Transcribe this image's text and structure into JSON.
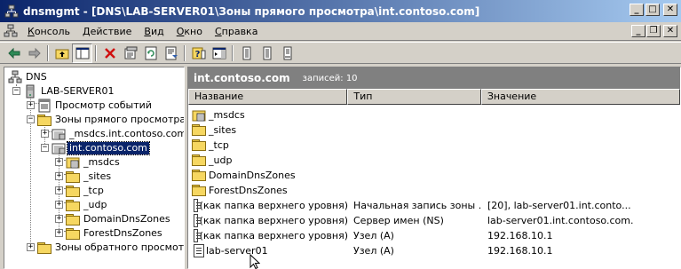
{
  "window": {
    "title": "dnsmgmt - [DNS\\LAB-SERVER01\\Зоны прямого просмотра\\int.contoso.com]"
  },
  "menu": {
    "items": [
      "Консоль",
      "Действие",
      "Вид",
      "Окно",
      "Справка"
    ],
    "underline": [
      "К",
      "Д",
      "В",
      "О",
      "С"
    ]
  },
  "toolbar": {
    "buttons": [
      "back-icon",
      "forward-icon",
      "up-folder-icon",
      "show-hide-tree-icon",
      "delete-icon",
      "properties-icon",
      "refresh-icon",
      "export-list-icon",
      "help-icon",
      "show-action-pane-icon",
      "new-record-icon",
      "record-type-icon",
      "ellipsis-icon"
    ]
  },
  "tree": {
    "root": "DNS",
    "server": "LAB-SERVER01",
    "events": "Просмотр событий",
    "forward": "Зоны прямого просмотра",
    "msdcs_zone": "_msdcs.int.contoso.com",
    "zone": "int.contoso.com",
    "children": [
      "_msdcs",
      "_sites",
      "_tcp",
      "_udp",
      "DomainDnsZones",
      "ForestDnsZones"
    ],
    "reverse": "Зоны обратного просмотра"
  },
  "pane": {
    "zone_name": "int.contoso.com",
    "record_count": "записей: 10",
    "columns": [
      "Название",
      "Тип",
      "Значение"
    ],
    "rows": [
      {
        "icon": "msdcs-folder-icon",
        "name": "_msdcs",
        "type": "",
        "value": ""
      },
      {
        "icon": "folder-icon",
        "name": "_sites",
        "type": "",
        "value": ""
      },
      {
        "icon": "folder-icon",
        "name": "_tcp",
        "type": "",
        "value": ""
      },
      {
        "icon": "folder-icon",
        "name": "_udp",
        "type": "",
        "value": ""
      },
      {
        "icon": "folder-icon",
        "name": "DomainDnsZones",
        "type": "",
        "value": ""
      },
      {
        "icon": "folder-icon",
        "name": "ForestDnsZones",
        "type": "",
        "value": ""
      },
      {
        "icon": "record-icon",
        "name": "(как папка верхнего уровня)",
        "type": "Начальная запись зоны ...",
        "value": "[20], lab-server01.int.conto..."
      },
      {
        "icon": "record-icon",
        "name": "(как папка верхнего уровня)",
        "type": "Сервер имен (NS)",
        "value": "lab-server01.int.contoso.com."
      },
      {
        "icon": "record-icon",
        "name": "(как папка верхнего уровня)",
        "type": "Узел (A)",
        "value": "192.168.10.1"
      },
      {
        "icon": "record-icon",
        "name": "lab-server01",
        "type": "Узел (A)",
        "value": "192.168.10.1"
      }
    ]
  },
  "colors": {
    "title_active": "#0a246a",
    "title_gradient_end": "#a6caf0",
    "selection": "#0a246a",
    "pane_header": "#808080",
    "chrome": "#d4d0c8"
  }
}
